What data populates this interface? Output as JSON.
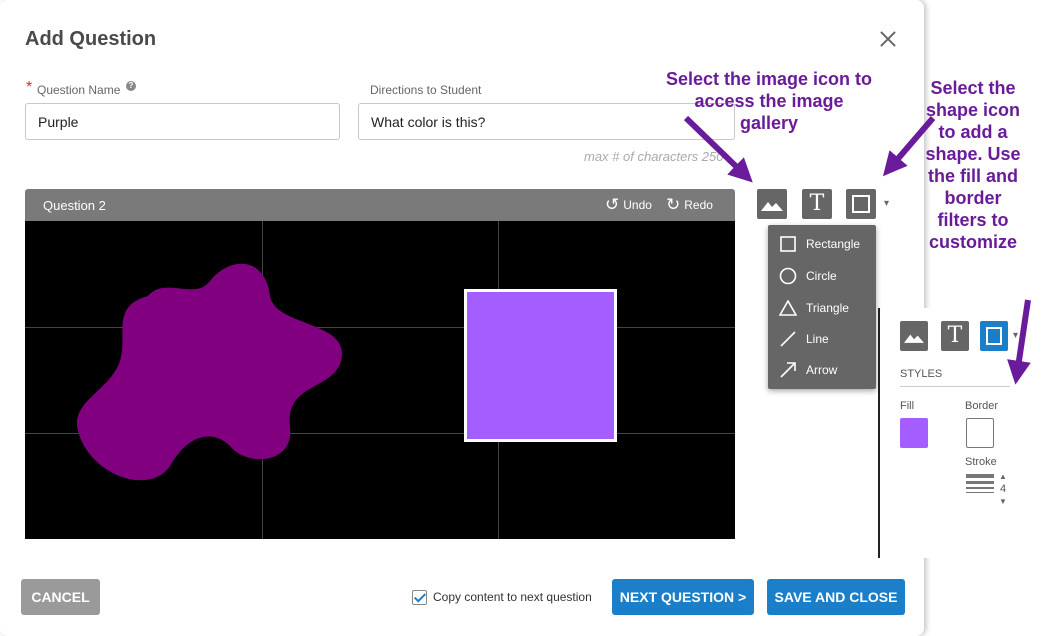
{
  "modal": {
    "title": "Add Question"
  },
  "form": {
    "question_name_label": "Question Name",
    "required_marker": "*",
    "help_glyph": "?",
    "question_name_value": "Purple",
    "directions_label": "Directions to Student",
    "directions_value": "What color is this?",
    "max_chars_hint": "max # of characters 250"
  },
  "canvas": {
    "title": "Question 2",
    "undo_label": "Undo",
    "redo_label": "Redo",
    "background": "#000000",
    "blob_color": "#800080",
    "square_color": "#a45eff"
  },
  "toolbar": {
    "image_tool": "image-icon",
    "text_tool": "T",
    "shape_tool": "square-icon",
    "caret": "▾"
  },
  "shape_menu": {
    "items": [
      {
        "label": "Rectangle",
        "icon": "rectangle-icon"
      },
      {
        "label": "Circle",
        "icon": "circle-icon"
      },
      {
        "label": "Triangle",
        "icon": "triangle-icon"
      },
      {
        "label": "Line",
        "icon": "line-icon"
      },
      {
        "label": "Arrow",
        "icon": "arrow-icon"
      }
    ]
  },
  "styles_panel": {
    "heading": "STYLES",
    "fill_label": "Fill",
    "border_label": "Border",
    "stroke_label": "Stroke",
    "stroke_value": "4",
    "fill_color": "#a45eff",
    "border_color": "#ffffff",
    "text_tool": "T",
    "caret": "▾",
    "step_up": "▲",
    "step_down": "▼"
  },
  "footer": {
    "cancel_label": "CANCEL",
    "copy_content_label": "Copy content to next question",
    "copy_content_checked": true,
    "next_label": "NEXT QUESTION >",
    "save_label": "SAVE AND CLOSE"
  },
  "annotations": {
    "image_note": "Select the image icon to access the image gallery",
    "shape_note": "Select the shape icon to add a shape. Use the fill and border filters to customize",
    "color": "#6a1b9a"
  },
  "colors": {
    "accent": "#1a7ec8",
    "tool_gray": "#666666",
    "header_gray": "#7a7a7a"
  }
}
